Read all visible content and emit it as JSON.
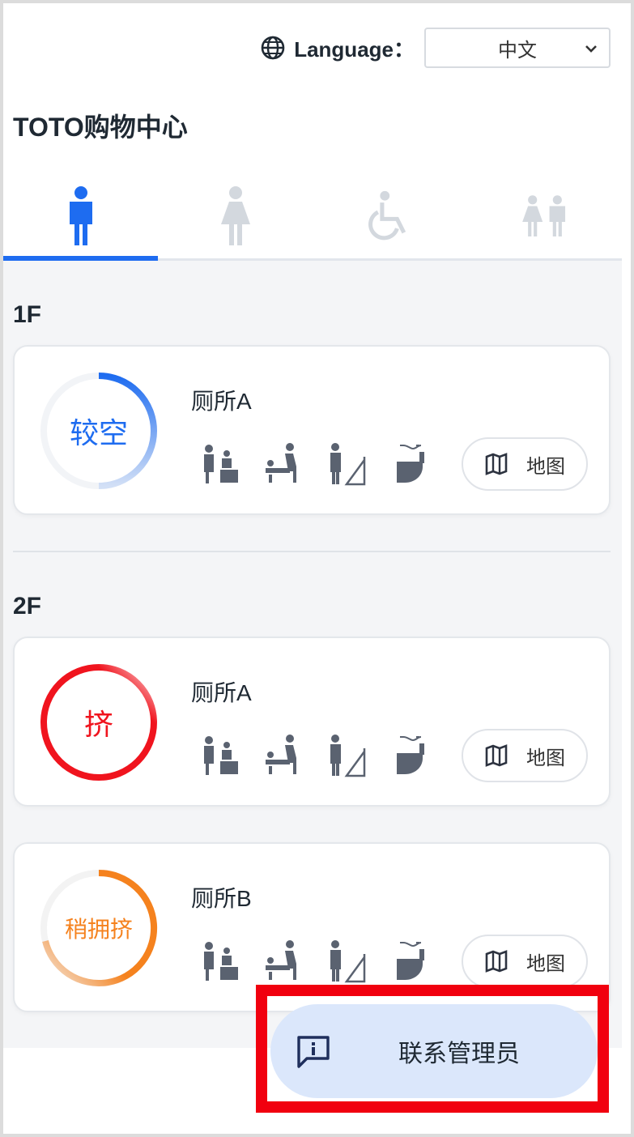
{
  "header": {
    "language_label": "Language：",
    "language_value": "中文",
    "globe_icon": "globe-icon",
    "chevron_icon": "chevron-down-icon"
  },
  "title": "TOTO购物中心",
  "tabs": [
    {
      "icon": "male-icon",
      "active": true
    },
    {
      "icon": "female-icon",
      "active": false
    },
    {
      "icon": "wheelchair-icon",
      "active": false
    },
    {
      "icon": "family-icon",
      "active": false
    }
  ],
  "floors": [
    {
      "label": "1F",
      "toilets": [
        {
          "name": "厕所A",
          "status": "较空",
          "status_color": "#1e6cf0",
          "map_label": "地图"
        }
      ]
    },
    {
      "label": "2F",
      "toilets": [
        {
          "name": "厕所A",
          "status": "挤",
          "status_color": "#f0141e",
          "map_label": "地图"
        },
        {
          "name": "厕所B",
          "status": "稍拥挤",
          "status_color": "#f5821e",
          "map_label": "地图"
        }
      ]
    }
  ],
  "amenity_icons": [
    "child-seat-icon",
    "baby-changing-icon",
    "urinal-icon",
    "washlet-icon"
  ],
  "contact": {
    "label": "联系管理员",
    "icon": "info-message-icon"
  },
  "colors": {
    "accent": "#1e6cf0",
    "crowded": "#f0141e",
    "moderate": "#f5821e",
    "highlight": "#f1000f"
  }
}
